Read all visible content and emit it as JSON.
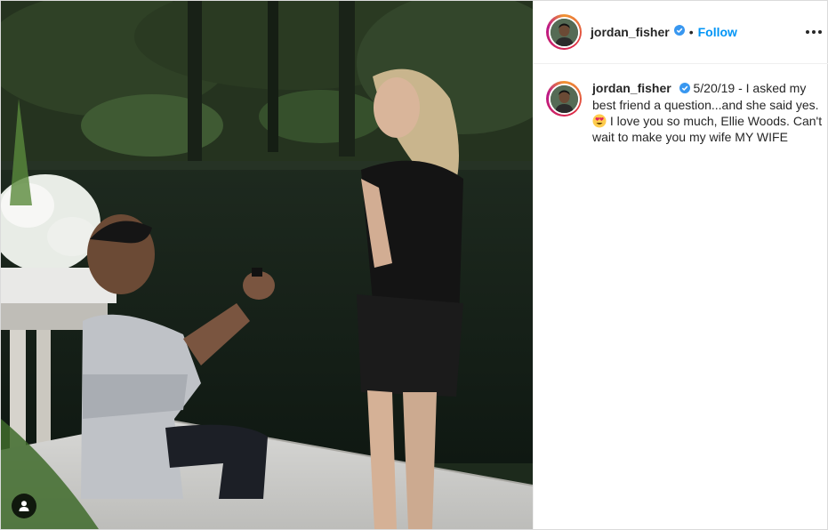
{
  "post": {
    "username": "jordan_fisher",
    "separator": "•",
    "follow_label": "Follow",
    "caption_part1": "5/20/19 - I asked my best friend a question...and she said yes.",
    "caption_part2": "I love you so much, Ellie Woods. Can't wait to make you my wife MY WIFE",
    "emoji": "heart-eyes-emoji"
  },
  "colors": {
    "link_blue": "#0095f6",
    "verified_blue": "#3897f0",
    "text": "#262626"
  },
  "icons": {
    "tag": "user-tag-icon",
    "more": "more-options-icon",
    "verified": "verified-badge-icon"
  }
}
